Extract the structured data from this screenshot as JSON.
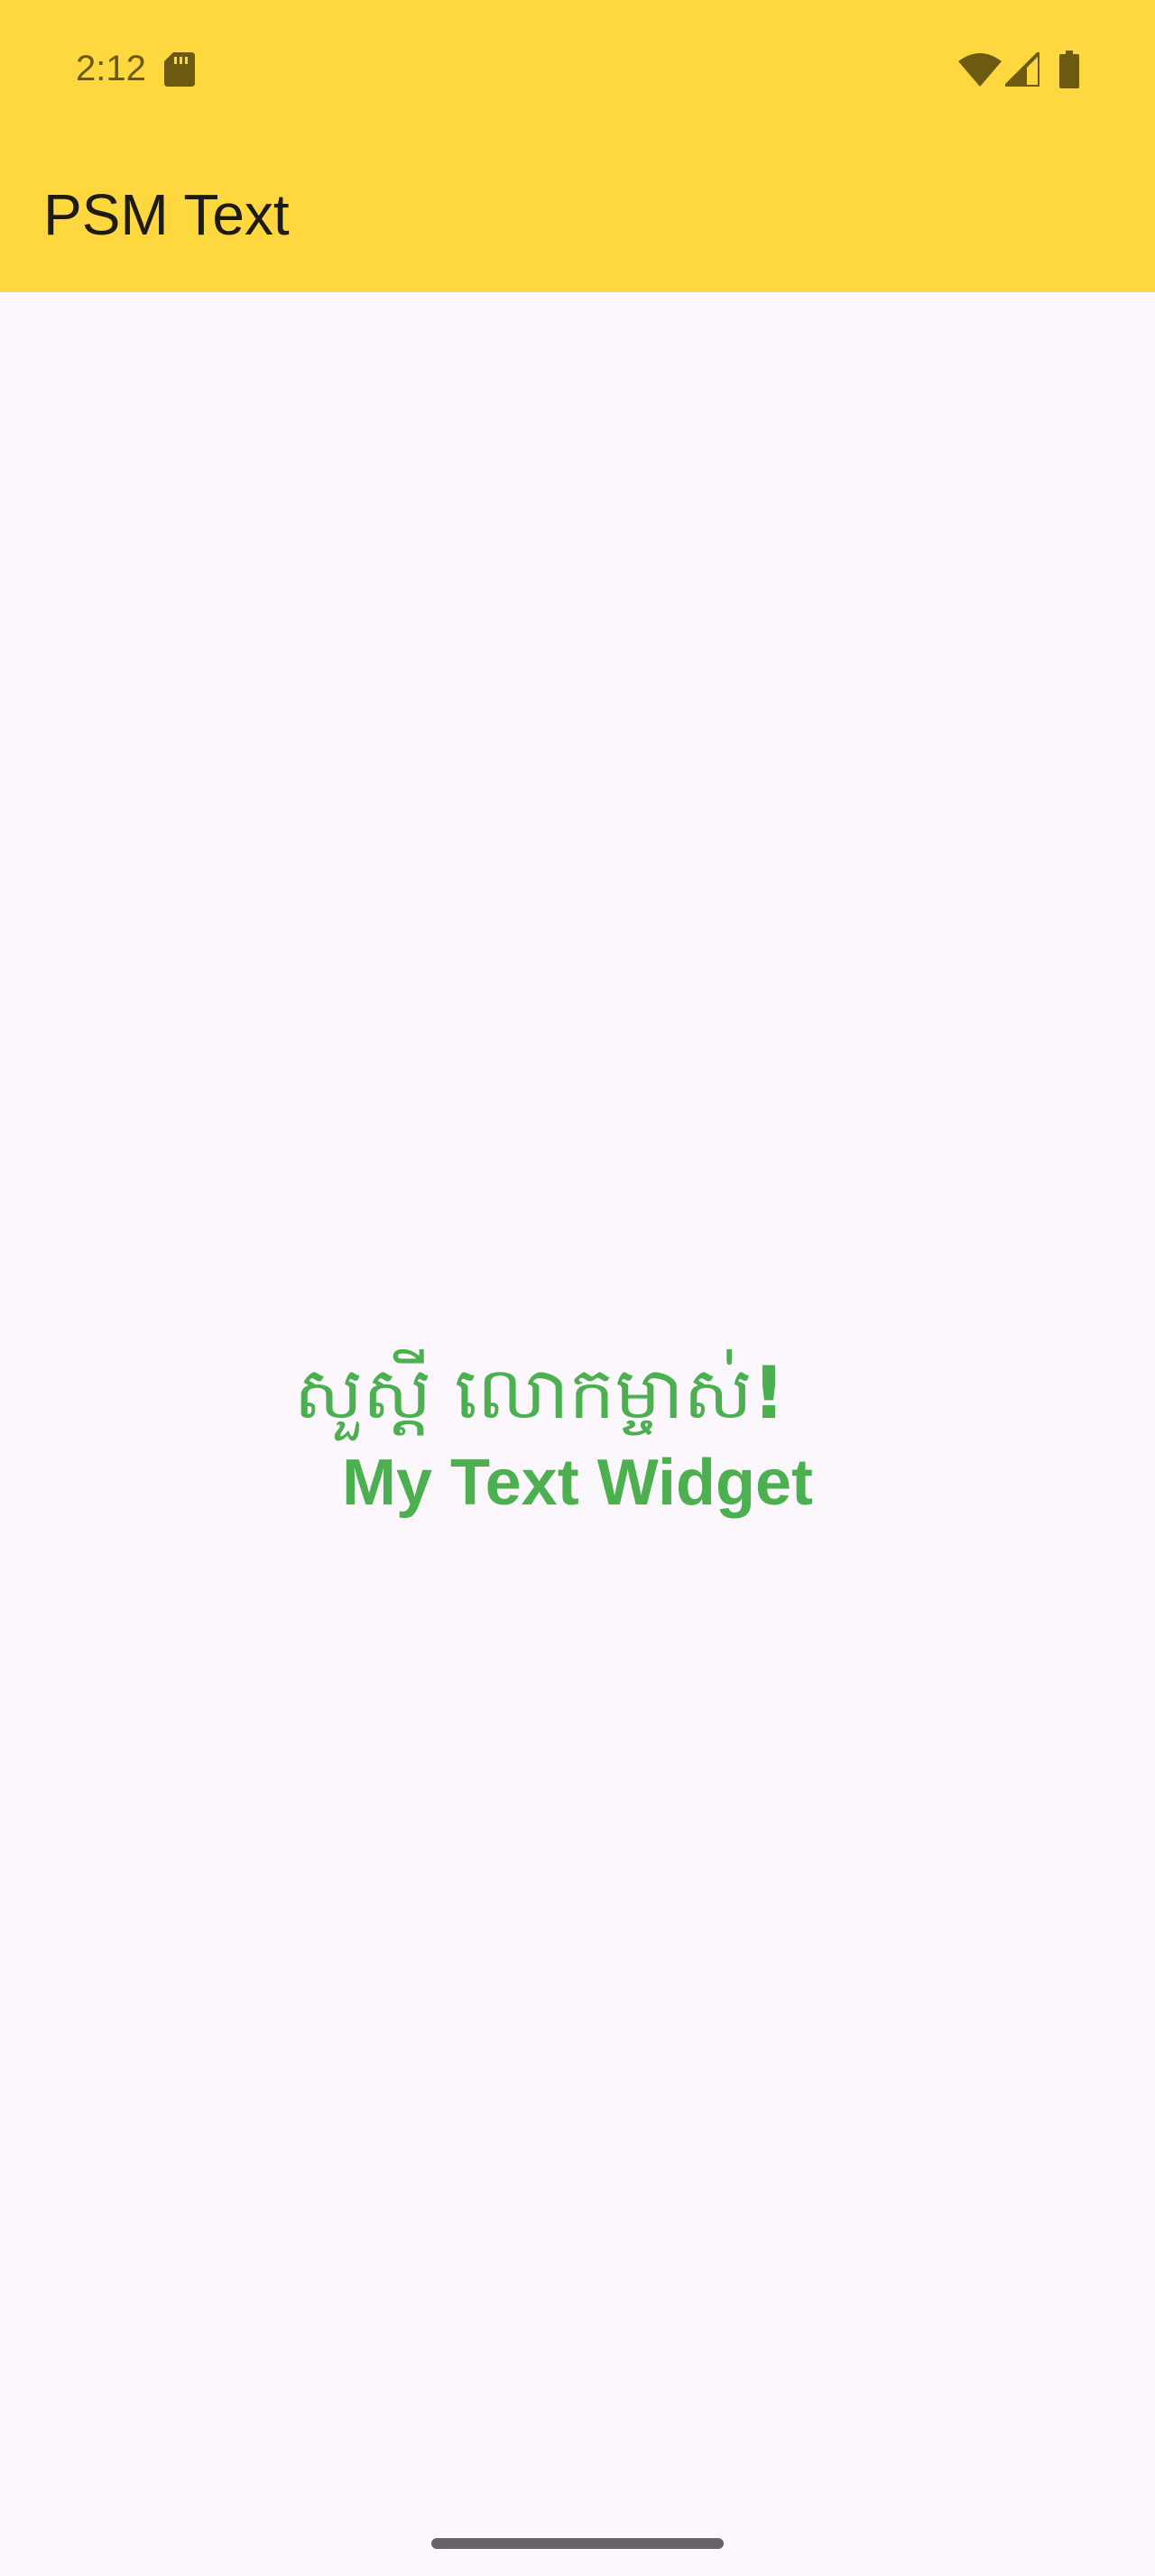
{
  "status_bar": {
    "time": "2:12",
    "icons": [
      "sd-card-icon",
      "wifi-icon",
      "cell-signal-icon",
      "battery-icon"
    ]
  },
  "app_bar": {
    "title": "PSM Text"
  },
  "content": {
    "greeting_text": "សួស្ដី លោកម្ចាស់",
    "greeting_punct": "!",
    "widget_text": "My Text Widget"
  },
  "colors": {
    "app_bar_bg": "#ffd840",
    "background": "#fcf7fc",
    "text_green": "#4caf50",
    "status_icon": "#6b5a10"
  }
}
